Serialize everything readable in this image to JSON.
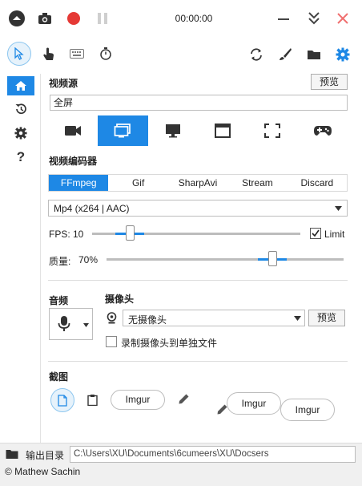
{
  "window": {
    "timer": "00:00:00"
  },
  "sidebar": {
    "items": [
      {
        "name": "home-icon",
        "active": true
      },
      {
        "name": "history-icon",
        "active": false
      },
      {
        "name": "settings-icon",
        "active": false
      },
      {
        "name": "help-icon",
        "glyph": "?",
        "active": false
      }
    ]
  },
  "video_source": {
    "label": "视频源",
    "preview_button": "预览",
    "value": "全屏",
    "modes": [
      "camera-icon",
      "screen-icon",
      "monitor-icon",
      "window-icon",
      "region-icon",
      "gamepad-icon"
    ],
    "active_mode": 1
  },
  "video_encoder": {
    "label": "视频编码器",
    "tabs": [
      "FFmpeg",
      "Gif",
      "SharpAvi",
      "Stream",
      "Discard"
    ],
    "active_tab": 0,
    "codec": "Mp4 (x264 | AAC)",
    "fps_label": "FPS:",
    "fps_value": "10",
    "limit_label": "Limit",
    "limit_checked": true,
    "quality_label": "质量:",
    "quality_value": "70%",
    "fps_level": 0.18,
    "quality_level": 0.7
  },
  "audio": {
    "label": "音频"
  },
  "webcam": {
    "label": "摄像头",
    "selected": "无摄像头",
    "preview_button": "预览",
    "separate_file_label": "录制摄像头到单独文件",
    "separate_file_checked": false
  },
  "screenshot": {
    "label": "截图",
    "imgur_1": "Imgur",
    "imgur_2": "Imgur",
    "imgur_3": "Imgur"
  },
  "output": {
    "label": "输出目录",
    "path": "C:\\Users\\XU\\Documents\\6cumeers\\XU\\Docsers"
  },
  "footer": {
    "copyright": "© Mathew Sachin"
  },
  "colors": {
    "accent": "#1e88e5",
    "record": "#e53935",
    "close": "#f07070"
  }
}
